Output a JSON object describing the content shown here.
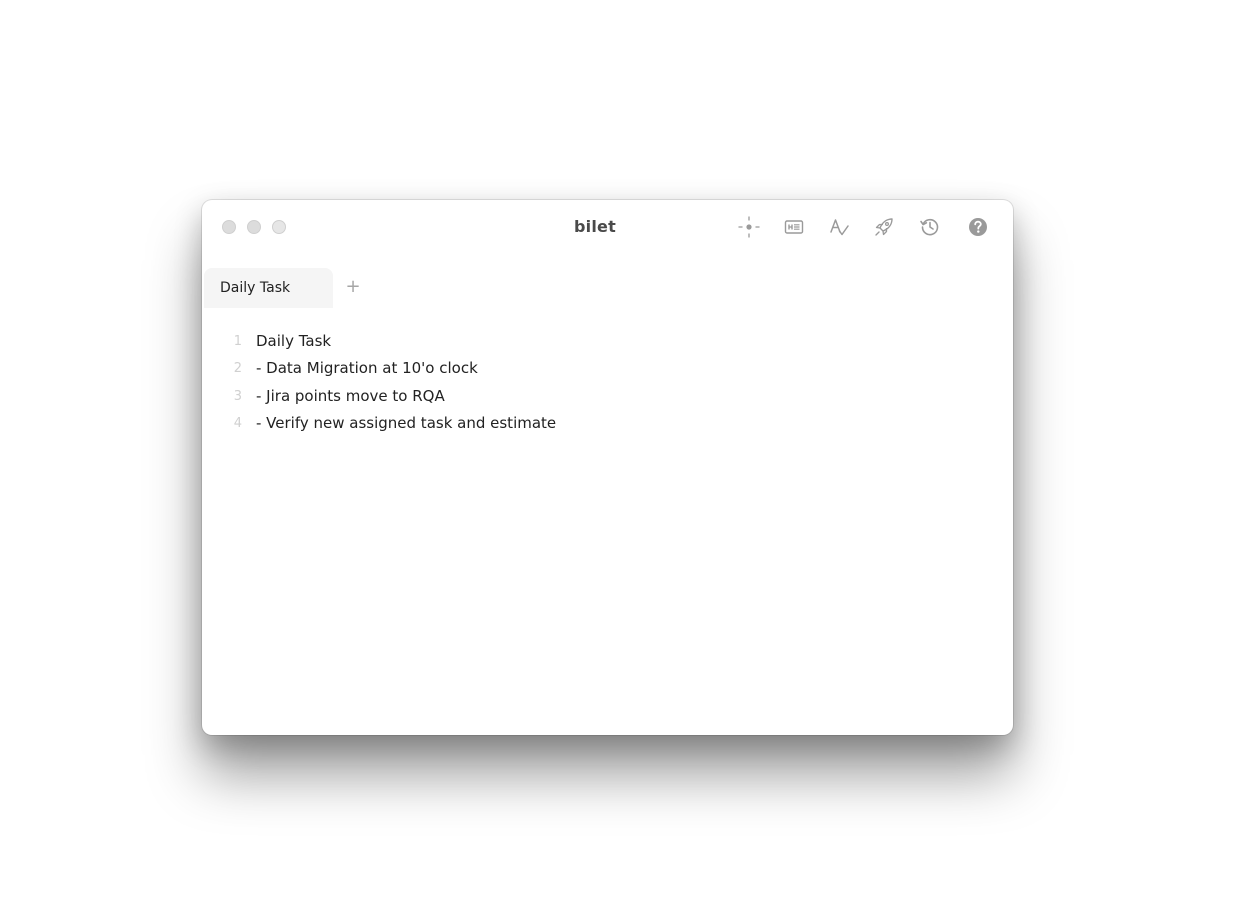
{
  "window": {
    "title": "bilet"
  },
  "toolbar": {
    "icons": [
      "focus-icon",
      "preview-icon",
      "spellcheck-icon",
      "publish-icon",
      "history-icon",
      "help-icon"
    ]
  },
  "tabs": [
    {
      "label": "Daily Task",
      "active": true
    }
  ],
  "add_tab_label": "+",
  "editor": {
    "lines": [
      {
        "number": "1",
        "text": "Daily Task"
      },
      {
        "number": "2",
        "text": "- Data Migration at 10'o clock"
      },
      {
        "number": "3",
        "text": "- Jira points move to RQA"
      },
      {
        "number": "4",
        "text": "- Verify new assigned task and estimate"
      }
    ]
  },
  "colors": {
    "icon": "#9a9a9a",
    "tab_active_bg": "#f5f5f5",
    "line_number": "#d0d0d0",
    "text": "#222222"
  }
}
